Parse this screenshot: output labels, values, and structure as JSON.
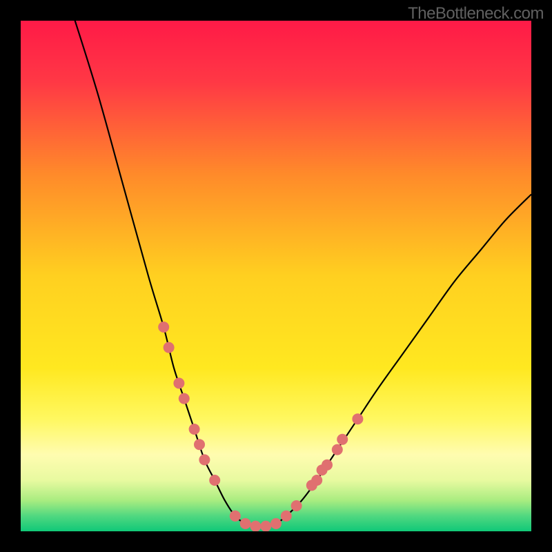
{
  "watermark": "TheBottleneck.com",
  "chart_data": {
    "type": "line",
    "title": "",
    "xlabel": "",
    "ylabel": "",
    "xlim": [
      0,
      100
    ],
    "ylim": [
      0,
      100
    ],
    "curve": {
      "description": "V-shaped bottleneck curve with minimum near x=47",
      "points": [
        {
          "x": 10,
          "y": 102
        },
        {
          "x": 15,
          "y": 86
        },
        {
          "x": 20,
          "y": 68
        },
        {
          "x": 25,
          "y": 50
        },
        {
          "x": 28,
          "y": 40
        },
        {
          "x": 30,
          "y": 32
        },
        {
          "x": 32,
          "y": 26
        },
        {
          "x": 34,
          "y": 20
        },
        {
          "x": 36,
          "y": 14
        },
        {
          "x": 38,
          "y": 10
        },
        {
          "x": 40,
          "y": 6
        },
        {
          "x": 42,
          "y": 3
        },
        {
          "x": 44,
          "y": 1.5
        },
        {
          "x": 46,
          "y": 1
        },
        {
          "x": 48,
          "y": 1
        },
        {
          "x": 50,
          "y": 1.5
        },
        {
          "x": 52,
          "y": 3
        },
        {
          "x": 55,
          "y": 6
        },
        {
          "x": 58,
          "y": 10
        },
        {
          "x": 62,
          "y": 16
        },
        {
          "x": 66,
          "y": 22
        },
        {
          "x": 70,
          "y": 28
        },
        {
          "x": 75,
          "y": 35
        },
        {
          "x": 80,
          "y": 42
        },
        {
          "x": 85,
          "y": 49
        },
        {
          "x": 90,
          "y": 55
        },
        {
          "x": 95,
          "y": 61
        },
        {
          "x": 100,
          "y": 66
        }
      ]
    },
    "data_markers": {
      "description": "salmon-colored circular markers on curve at sample positions",
      "color": "#e07070",
      "radius": 8,
      "points": [
        {
          "x": 28,
          "y": 40
        },
        {
          "x": 29,
          "y": 36
        },
        {
          "x": 31,
          "y": 29
        },
        {
          "x": 32,
          "y": 26
        },
        {
          "x": 34,
          "y": 20
        },
        {
          "x": 35,
          "y": 17
        },
        {
          "x": 36,
          "y": 14
        },
        {
          "x": 38,
          "y": 10
        },
        {
          "x": 42,
          "y": 3
        },
        {
          "x": 44,
          "y": 1.5
        },
        {
          "x": 46,
          "y": 1
        },
        {
          "x": 48,
          "y": 1
        },
        {
          "x": 50,
          "y": 1.5
        },
        {
          "x": 52,
          "y": 3
        },
        {
          "x": 54,
          "y": 5
        },
        {
          "x": 57,
          "y": 9
        },
        {
          "x": 58,
          "y": 10
        },
        {
          "x": 59,
          "y": 12
        },
        {
          "x": 60,
          "y": 13
        },
        {
          "x": 62,
          "y": 16
        },
        {
          "x": 63,
          "y": 18
        },
        {
          "x": 66,
          "y": 22
        }
      ]
    },
    "background_gradient": {
      "type": "vertical",
      "stops": [
        {
          "offset": 0,
          "color": "#ff1a47"
        },
        {
          "offset": 0.12,
          "color": "#ff3845"
        },
        {
          "offset": 0.3,
          "color": "#ff8a2a"
        },
        {
          "offset": 0.5,
          "color": "#ffd020"
        },
        {
          "offset": 0.68,
          "color": "#ffe820"
        },
        {
          "offset": 0.78,
          "color": "#fff860"
        },
        {
          "offset": 0.85,
          "color": "#fffcb0"
        },
        {
          "offset": 0.9,
          "color": "#e8faa0"
        },
        {
          "offset": 0.94,
          "color": "#a8ec80"
        },
        {
          "offset": 0.97,
          "color": "#50d880"
        },
        {
          "offset": 1.0,
          "color": "#10c878"
        }
      ]
    }
  }
}
